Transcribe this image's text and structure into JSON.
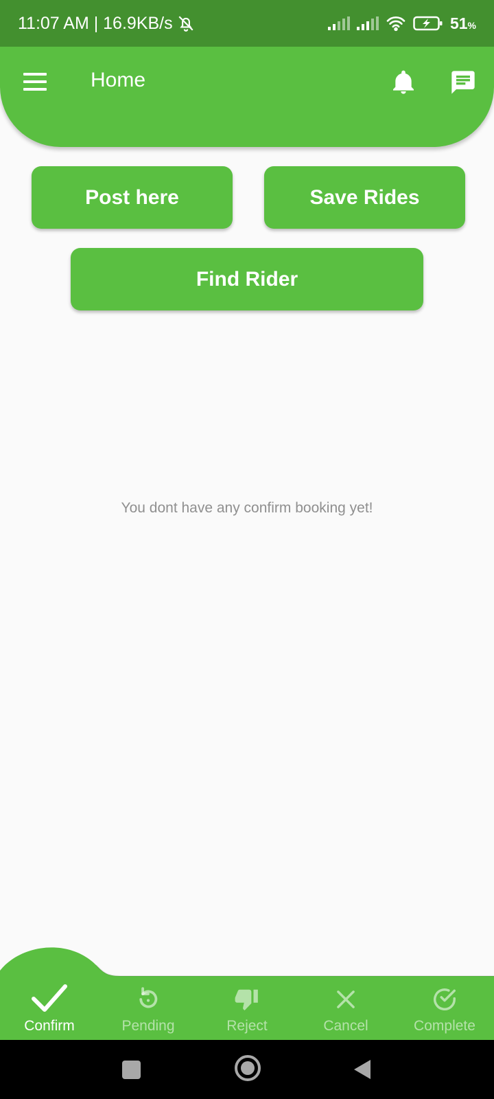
{
  "status_bar": {
    "time": "11:07 AM | 16.9KB/s",
    "battery_percent": "51",
    "battery_unit": "%"
  },
  "app_bar": {
    "title": "Home",
    "icons": [
      "menu-icon",
      "bell-icon",
      "chat-icon"
    ]
  },
  "actions": {
    "post_label": "Post here",
    "save_label": "Save Rides",
    "find_label": "Find Rider"
  },
  "main": {
    "empty_message": "You dont have any confirm booking yet!"
  },
  "bottom_nav": {
    "items": [
      {
        "label": "Confirm",
        "icon": "check-icon",
        "active": true
      },
      {
        "label": "Pending",
        "icon": "refresh-icon",
        "active": false
      },
      {
        "label": "Reject",
        "icon": "thumbs-down-icon",
        "active": false
      },
      {
        "label": "Cancel",
        "icon": "close-icon",
        "active": false
      },
      {
        "label": "Complete",
        "icon": "check-circle-icon",
        "active": false
      }
    ]
  },
  "colors": {
    "status_bar": "#43902f",
    "primary": "#5abf41",
    "background": "#fafafa",
    "muted_text": "#8f8f8f"
  }
}
